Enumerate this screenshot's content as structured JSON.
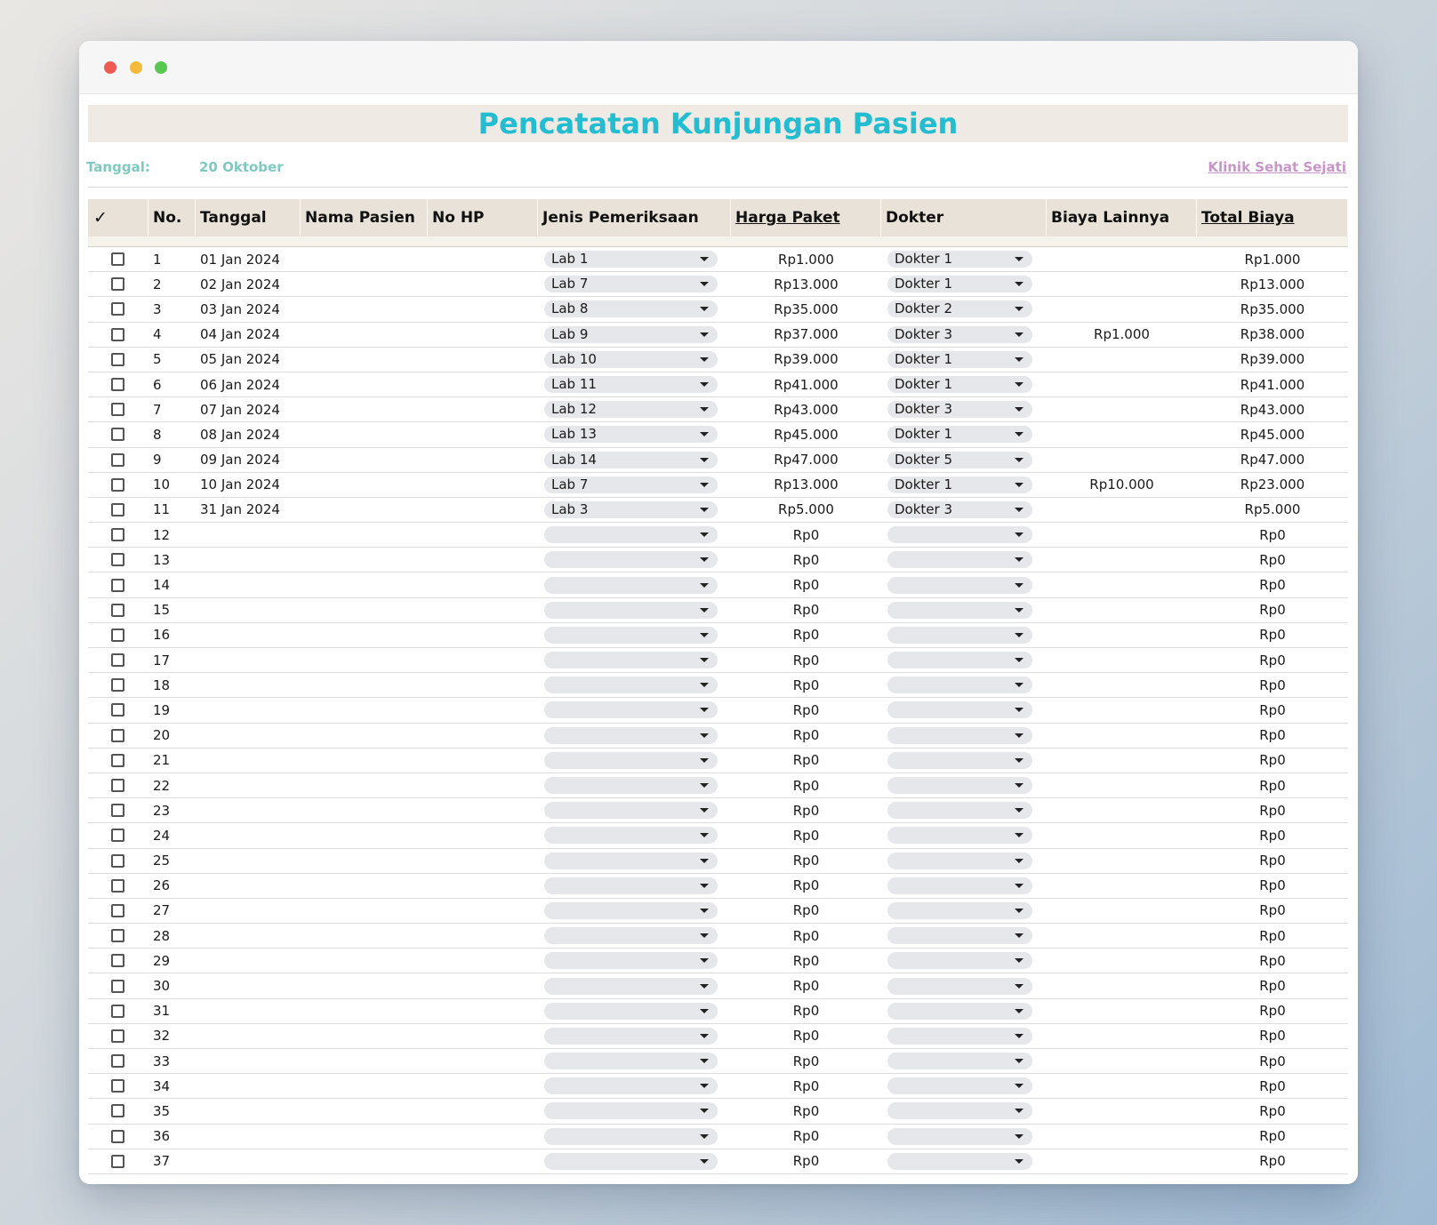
{
  "sheet": {
    "title": "Pencatatan Kunjungan Pasien",
    "date_label": "Tanggal:",
    "date_value": "20 Oktober",
    "clinic_name": "Klinik Sehat Sejati"
  },
  "table": {
    "headers": {
      "check": "✓",
      "no": "No.",
      "tanggal": "Tanggal",
      "nama": "Nama Pasien",
      "nohp": "No HP",
      "jenis": "Jenis Pemeriksaan",
      "harga": "Harga Paket",
      "dokter": "Dokter",
      "biaya": "Biaya Lainnya",
      "total": "Total Biaya"
    },
    "rows": [
      {
        "no": "1",
        "tanggal": "01 Jan 2024",
        "nama": "",
        "nohp": "",
        "jenis": "Lab 1",
        "harga": "Rp1.000",
        "dokter": "Dokter 1",
        "biaya": "",
        "total": "Rp1.000"
      },
      {
        "no": "2",
        "tanggal": "02 Jan 2024",
        "nama": "",
        "nohp": "",
        "jenis": "Lab 7",
        "harga": "Rp13.000",
        "dokter": "Dokter 1",
        "biaya": "",
        "total": "Rp13.000"
      },
      {
        "no": "3",
        "tanggal": "03 Jan 2024",
        "nama": "",
        "nohp": "",
        "jenis": "Lab 8",
        "harga": "Rp35.000",
        "dokter": "Dokter 2",
        "biaya": "",
        "total": "Rp35.000"
      },
      {
        "no": "4",
        "tanggal": "04 Jan 2024",
        "nama": "",
        "nohp": "",
        "jenis": "Lab 9",
        "harga": "Rp37.000",
        "dokter": "Dokter 3",
        "biaya": "Rp1.000",
        "total": "Rp38.000"
      },
      {
        "no": "5",
        "tanggal": "05 Jan 2024",
        "nama": "",
        "nohp": "",
        "jenis": "Lab 10",
        "harga": "Rp39.000",
        "dokter": "Dokter 1",
        "biaya": "",
        "total": "Rp39.000"
      },
      {
        "no": "6",
        "tanggal": "06 Jan 2024",
        "nama": "",
        "nohp": "",
        "jenis": "Lab 11",
        "harga": "Rp41.000",
        "dokter": "Dokter 1",
        "biaya": "",
        "total": "Rp41.000"
      },
      {
        "no": "7",
        "tanggal": "07 Jan 2024",
        "nama": "",
        "nohp": "",
        "jenis": "Lab 12",
        "harga": "Rp43.000",
        "dokter": "Dokter 3",
        "biaya": "",
        "total": "Rp43.000"
      },
      {
        "no": "8",
        "tanggal": "08 Jan 2024",
        "nama": "",
        "nohp": "",
        "jenis": "Lab 13",
        "harga": "Rp45.000",
        "dokter": "Dokter 1",
        "biaya": "",
        "total": "Rp45.000"
      },
      {
        "no": "9",
        "tanggal": "09 Jan 2024",
        "nama": "",
        "nohp": "",
        "jenis": "Lab 14",
        "harga": "Rp47.000",
        "dokter": "Dokter 5",
        "biaya": "",
        "total": "Rp47.000"
      },
      {
        "no": "10",
        "tanggal": "10 Jan 2024",
        "nama": "",
        "nohp": "",
        "jenis": "Lab 7",
        "harga": "Rp13.000",
        "dokter": "Dokter 1",
        "biaya": "Rp10.000",
        "total": "Rp23.000"
      },
      {
        "no": "11",
        "tanggal": "31 Jan 2024",
        "nama": "",
        "nohp": "",
        "jenis": "Lab 3",
        "harga": "Rp5.000",
        "dokter": "Dokter 3",
        "biaya": "",
        "total": "Rp5.000"
      },
      {
        "no": "12",
        "tanggal": "",
        "nama": "",
        "nohp": "",
        "jenis": "",
        "harga": "Rp0",
        "dokter": "",
        "biaya": "",
        "total": "Rp0"
      },
      {
        "no": "13",
        "tanggal": "",
        "nama": "",
        "nohp": "",
        "jenis": "",
        "harga": "Rp0",
        "dokter": "",
        "biaya": "",
        "total": "Rp0"
      },
      {
        "no": "14",
        "tanggal": "",
        "nama": "",
        "nohp": "",
        "jenis": "",
        "harga": "Rp0",
        "dokter": "",
        "biaya": "",
        "total": "Rp0"
      },
      {
        "no": "15",
        "tanggal": "",
        "nama": "",
        "nohp": "",
        "jenis": "",
        "harga": "Rp0",
        "dokter": "",
        "biaya": "",
        "total": "Rp0"
      },
      {
        "no": "16",
        "tanggal": "",
        "nama": "",
        "nohp": "",
        "jenis": "",
        "harga": "Rp0",
        "dokter": "",
        "biaya": "",
        "total": "Rp0"
      },
      {
        "no": "17",
        "tanggal": "",
        "nama": "",
        "nohp": "",
        "jenis": "",
        "harga": "Rp0",
        "dokter": "",
        "biaya": "",
        "total": "Rp0"
      },
      {
        "no": "18",
        "tanggal": "",
        "nama": "",
        "nohp": "",
        "jenis": "",
        "harga": "Rp0",
        "dokter": "",
        "biaya": "",
        "total": "Rp0"
      },
      {
        "no": "19",
        "tanggal": "",
        "nama": "",
        "nohp": "",
        "jenis": "",
        "harga": "Rp0",
        "dokter": "",
        "biaya": "",
        "total": "Rp0"
      },
      {
        "no": "20",
        "tanggal": "",
        "nama": "",
        "nohp": "",
        "jenis": "",
        "harga": "Rp0",
        "dokter": "",
        "biaya": "",
        "total": "Rp0"
      },
      {
        "no": "21",
        "tanggal": "",
        "nama": "",
        "nohp": "",
        "jenis": "",
        "harga": "Rp0",
        "dokter": "",
        "biaya": "",
        "total": "Rp0"
      },
      {
        "no": "22",
        "tanggal": "",
        "nama": "",
        "nohp": "",
        "jenis": "",
        "harga": "Rp0",
        "dokter": "",
        "biaya": "",
        "total": "Rp0"
      },
      {
        "no": "23",
        "tanggal": "",
        "nama": "",
        "nohp": "",
        "jenis": "",
        "harga": "Rp0",
        "dokter": "",
        "biaya": "",
        "total": "Rp0"
      },
      {
        "no": "24",
        "tanggal": "",
        "nama": "",
        "nohp": "",
        "jenis": "",
        "harga": "Rp0",
        "dokter": "",
        "biaya": "",
        "total": "Rp0"
      },
      {
        "no": "25",
        "tanggal": "",
        "nama": "",
        "nohp": "",
        "jenis": "",
        "harga": "Rp0",
        "dokter": "",
        "biaya": "",
        "total": "Rp0"
      },
      {
        "no": "26",
        "tanggal": "",
        "nama": "",
        "nohp": "",
        "jenis": "",
        "harga": "Rp0",
        "dokter": "",
        "biaya": "",
        "total": "Rp0"
      },
      {
        "no": "27",
        "tanggal": "",
        "nama": "",
        "nohp": "",
        "jenis": "",
        "harga": "Rp0",
        "dokter": "",
        "biaya": "",
        "total": "Rp0"
      },
      {
        "no": "28",
        "tanggal": "",
        "nama": "",
        "nohp": "",
        "jenis": "",
        "harga": "Rp0",
        "dokter": "",
        "biaya": "",
        "total": "Rp0"
      },
      {
        "no": "29",
        "tanggal": "",
        "nama": "",
        "nohp": "",
        "jenis": "",
        "harga": "Rp0",
        "dokter": "",
        "biaya": "",
        "total": "Rp0"
      },
      {
        "no": "30",
        "tanggal": "",
        "nama": "",
        "nohp": "",
        "jenis": "",
        "harga": "Rp0",
        "dokter": "",
        "biaya": "",
        "total": "Rp0"
      },
      {
        "no": "31",
        "tanggal": "",
        "nama": "",
        "nohp": "",
        "jenis": "",
        "harga": "Rp0",
        "dokter": "",
        "biaya": "",
        "total": "Rp0"
      },
      {
        "no": "32",
        "tanggal": "",
        "nama": "",
        "nohp": "",
        "jenis": "",
        "harga": "Rp0",
        "dokter": "",
        "biaya": "",
        "total": "Rp0"
      },
      {
        "no": "33",
        "tanggal": "",
        "nama": "",
        "nohp": "",
        "jenis": "",
        "harga": "Rp0",
        "dokter": "",
        "biaya": "",
        "total": "Rp0"
      },
      {
        "no": "34",
        "tanggal": "",
        "nama": "",
        "nohp": "",
        "jenis": "",
        "harga": "Rp0",
        "dokter": "",
        "biaya": "",
        "total": "Rp0"
      },
      {
        "no": "35",
        "tanggal": "",
        "nama": "",
        "nohp": "",
        "jenis": "",
        "harga": "Rp0",
        "dokter": "",
        "biaya": "",
        "total": "Rp0"
      },
      {
        "no": "36",
        "tanggal": "",
        "nama": "",
        "nohp": "",
        "jenis": "",
        "harga": "Rp0",
        "dokter": "",
        "biaya": "",
        "total": "Rp0"
      },
      {
        "no": "37",
        "tanggal": "",
        "nama": "",
        "nohp": "",
        "jenis": "",
        "harga": "Rp0",
        "dokter": "",
        "biaya": "",
        "total": "Rp0"
      }
    ]
  },
  "colors": {
    "title": "#23bcd0",
    "meta_label": "#7fc9c0",
    "clinic_link": "#c895c9",
    "header_bg": "#e8e2d8",
    "banner_bg": "#efebe4",
    "chip_bg": "#e6e7ea"
  }
}
